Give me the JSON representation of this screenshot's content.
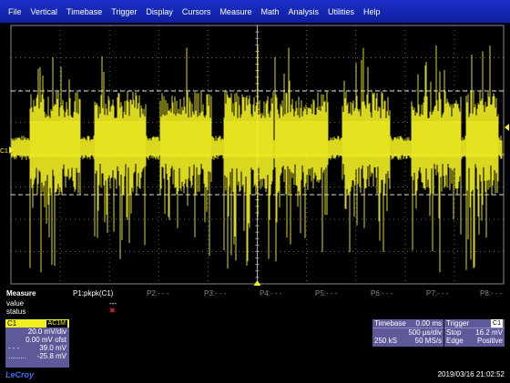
{
  "menu": [
    "File",
    "Vertical",
    "Timebase",
    "Trigger",
    "Display",
    "Cursors",
    "Measure",
    "Math",
    "Analysis",
    "Utilities",
    "Help"
  ],
  "channel_marker": "C1",
  "trace_color": "#f2ef21",
  "measure": {
    "title": "Measure",
    "params": [
      "P1:pkpk(C1)",
      "P2:- - -",
      "P3:- - -",
      "P4:- - -",
      "P5:- - -",
      "P6:- - -",
      "P7:- - -",
      "P8:- - -"
    ],
    "row_labels": [
      "value",
      "status"
    ],
    "value": "---",
    "status_icon": "red-x-icon"
  },
  "c1": {
    "label": "C1",
    "coupling": "AC1M",
    "vdiv": "20.0 mV/div",
    "offset": "0.00 mV ofst",
    "cursor1_marker": "- - -",
    "cursor1_value": "39.0 mV",
    "cursor2_marker": ".........",
    "cursor2_value": "-25.8 mV"
  },
  "timebase": {
    "label": "Timebase",
    "delay": "0.00 ms",
    "tdiv": "500 µs/div",
    "samples": "250 kS",
    "rate": "50 MS/s"
  },
  "trigger": {
    "label": "Trigger",
    "source": "C1",
    "mode": "Stop",
    "level": "16.2 mV",
    "type": "Edge",
    "slope": "Positive"
  },
  "brand": "LeCroy",
  "timestamp": "2019/03/16 21:02:52"
}
